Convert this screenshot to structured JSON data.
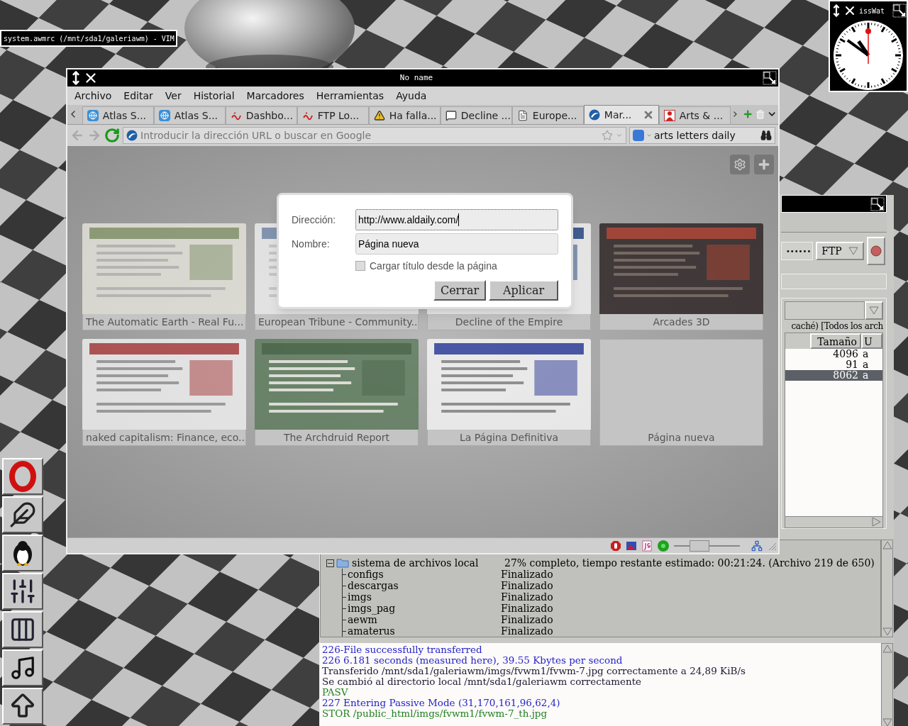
{
  "vim_window": {
    "title": "system.awmrc (/mnt/sda1/galeriawm) - VIM"
  },
  "clock": {
    "title": "issWat"
  },
  "browser": {
    "title": "No name",
    "menu": [
      "Archivo",
      "Editar",
      "Ver",
      "Historial",
      "Marcadores",
      "Herramientas",
      "Ayuda"
    ],
    "tabs": [
      {
        "label": "Atlas S...",
        "kind": "globe",
        "selected": false
      },
      {
        "label": "Atlas S...",
        "kind": "globe",
        "selected": false
      },
      {
        "label": "Dashbo...",
        "kind": "script",
        "selected": false
      },
      {
        "label": "FTP Lo...",
        "kind": "script",
        "selected": false
      },
      {
        "label": "Ha falla...",
        "kind": "warning",
        "selected": false
      },
      {
        "label": "Decline ...",
        "kind": "speech",
        "selected": false
      },
      {
        "label": "Europe...",
        "kind": "page",
        "selected": false
      },
      {
        "label": "Mar...",
        "kind": "swirl",
        "selected": true
      },
      {
        "label": "Arts & ...",
        "kind": "figure",
        "selected": false
      }
    ],
    "address": {
      "placeholder": "Introducir la dirección URL o buscar en Google"
    },
    "search": {
      "value": "arts letters daily"
    },
    "speed_dial": [
      {
        "title": "The Automatic Earth - Real Fu...",
        "kind": "picture"
      },
      {
        "title": "European Tribune - Community..",
        "kind": "picture"
      },
      {
        "title": "Decline of the Empire",
        "kind": "picture"
      },
      {
        "title": "Arcades 3D",
        "kind": "picture"
      },
      {
        "title": "naked capitalism: Finance, eco..",
        "kind": "picture"
      },
      {
        "title": "The Archdruid Report",
        "kind": "picture"
      },
      {
        "title": "La Página Definitiva",
        "kind": "picture"
      },
      {
        "title": "Página nueva",
        "kind": "empty"
      }
    ],
    "dialog": {
      "fields": [
        {
          "label": "Dirección:",
          "value": "http://www.aldaily.com/",
          "focused": true
        },
        {
          "label": "Nombre:",
          "value": "Página nueva",
          "focused": false
        }
      ],
      "checkbox": {
        "label": "Cargar título desde la página",
        "checked": false
      },
      "buttons": [
        "Cerrar",
        "Aplicar"
      ]
    },
    "status_bar": {
      "zoom": {
        "level": 0.39
      }
    }
  },
  "ftp": {
    "connection": {
      "password": "••••••",
      "protocol": "FTP"
    },
    "remote": {
      "path_text": "caché) [Todos los arch",
      "columns": [
        "Tamaño",
        "U"
      ],
      "rows": [
        {
          "cells": [
            "4096",
            "a"
          ],
          "selected": false
        },
        {
          "cells": [
            "91",
            "a"
          ],
          "selected": false
        },
        {
          "cells": [
            "8062",
            "a"
          ],
          "selected": true
        }
      ]
    },
    "transfers": [
      {
        "name": "sistema de archivos local",
        "status": "27% completo, tiempo restante estimado: 00:21:24. (Archivo 219 de 650)",
        "expanded": true,
        "children": [
          {
            "name": "configs",
            "status": "Finalizado"
          },
          {
            "name": "descargas",
            "status": "Finalizado"
          },
          {
            "name": "imgs",
            "status": "Finalizado"
          },
          {
            "name": "imgs_pag",
            "status": "Finalizado"
          },
          {
            "name": "aewm",
            "status": "Finalizado"
          },
          {
            "name": "amaterus",
            "status": "Finalizado"
          }
        ]
      }
    ],
    "log": [
      {
        "text": "226-File successfully transferred",
        "color": "#2424c8"
      },
      {
        "text": "226 6.181 seconds (measured here), 39.55 Kbytes per second",
        "color": "#2424c8"
      },
      {
        "text": "Transferido /mnt/sda1/galeriawm/imgs/fvwm1/fvwm-7.jpg correctamente a 24,89 KiB/s",
        "color": "#1a1a30"
      },
      {
        "text": "Se cambió al directorio local /mnt/sda1/galeriawm correctamente",
        "color": "#1a1a30"
      },
      {
        "text": "PASV",
        "color": "#208020"
      },
      {
        "text": "227 Entering Passive Mode (31,170,161,96,62,4)",
        "color": "#2424c8"
      },
      {
        "text": "STOR /public_html/imgs/fvwm1/fvwm-7_th.jpg",
        "color": "#208020"
      }
    ]
  }
}
